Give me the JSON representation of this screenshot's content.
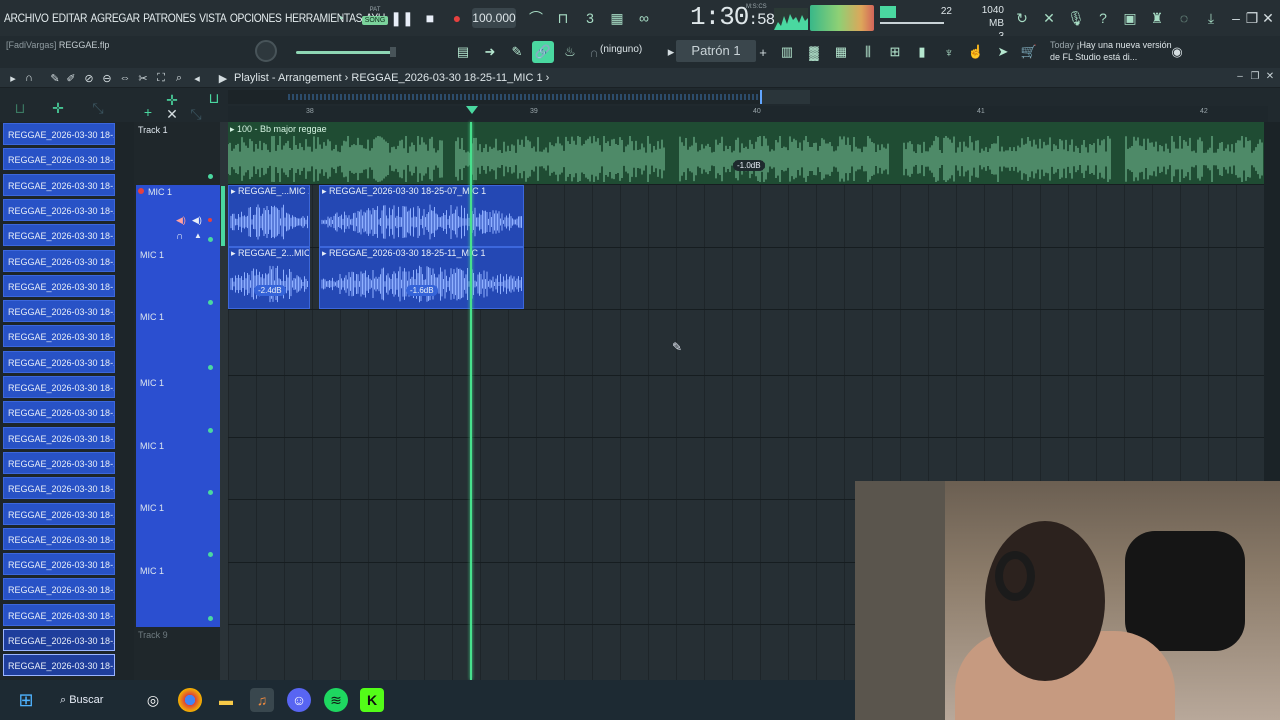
{
  "menu": [
    "ARCHIVO",
    "EDITAR",
    "AGREGAR",
    "PATRONES",
    "VISTA",
    "OPCIONES",
    "HERRAMIENTAS",
    "AYU"
  ],
  "transport": {
    "pat_label": "PAT",
    "song_label": "SONG",
    "tempo": "100.000"
  },
  "clock": {
    "main": "1:30",
    "sub": "58",
    "unit": "M:S:CS"
  },
  "system": {
    "cpu_value": "22",
    "memory": "1040 MB",
    "poly": "3"
  },
  "project": {
    "user": "[FadiVargas]",
    "file": "REGGAE.flp"
  },
  "snap": "(ninguno)",
  "pattern": "Patrón 1",
  "news": {
    "when": "Today",
    "text": "¡Hay una nueva versión de FL Studio está di..."
  },
  "playlist": {
    "title": "Playlist - Arrangement",
    "separator": "›",
    "clip": "REGGAE_2026-03-30 18-25-11_MIC 1"
  },
  "ruler": {
    "bars": [
      "38",
      "39",
      "40",
      "41",
      "42"
    ]
  },
  "browser_items": [
    "REGGAE_2026-03-30 18-...",
    "REGGAE_2026-03-30 18-...",
    "REGGAE_2026-03-30 18-...",
    "REGGAE_2026-03-30 18-...",
    "REGGAE_2026-03-30 18-...",
    "REGGAE_2026-03-30 18-...",
    "REGGAE_2026-03-30 18-...",
    "REGGAE_2026-03-30 18-...",
    "REGGAE_2026-03-30 18-...",
    "REGGAE_2026-03-30 18-...",
    "REGGAE_2026-03-30 18-...",
    "REGGAE_2026-03-30 18-...",
    "REGGAE_2026-03-30 18-...",
    "REGGAE_2026-03-30 18-...",
    "REGGAE_2026-03-30 18-...",
    "REGGAE_2026-03-30 18-...",
    "REGGAE_2026-03-30 18-...",
    "REGGAE_2026-03-30 18-...",
    "REGGAE_2026-03-30 18-...",
    "REGGAE_2026-03-30 18-...",
    "REGGAE_2026-03-30 18-...",
    "REGGAE_2026-03-30 18-..."
  ],
  "tracks": [
    "Track 1",
    "MIC 1",
    "MIC 1",
    "MIC 1",
    "MIC 1",
    "MIC 1",
    "MIC 1",
    "MIC 1",
    "Track 9"
  ],
  "clips": {
    "beat": {
      "label": "100 - Bb major reggae",
      "db": "-1.0dB"
    },
    "row2a": {
      "label": "REGGAE_...MIC 1"
    },
    "row2b": {
      "label": "REGGAE_2026-03-30 18-25-07_MIC 1"
    },
    "row3a": {
      "label": "REGGAE_2...MIC 1",
      "db": "-2.4dB"
    },
    "row3b": {
      "label": "REGGAE_2026-03-30 18-25-11_MIC 1",
      "db": "-1.6dB"
    }
  },
  "taskbar": {
    "search_label": "Buscar"
  },
  "colors": {
    "accent": "#4ad8a0",
    "clip_blue": "#2448b4",
    "audio_green": "#1f4c33"
  }
}
